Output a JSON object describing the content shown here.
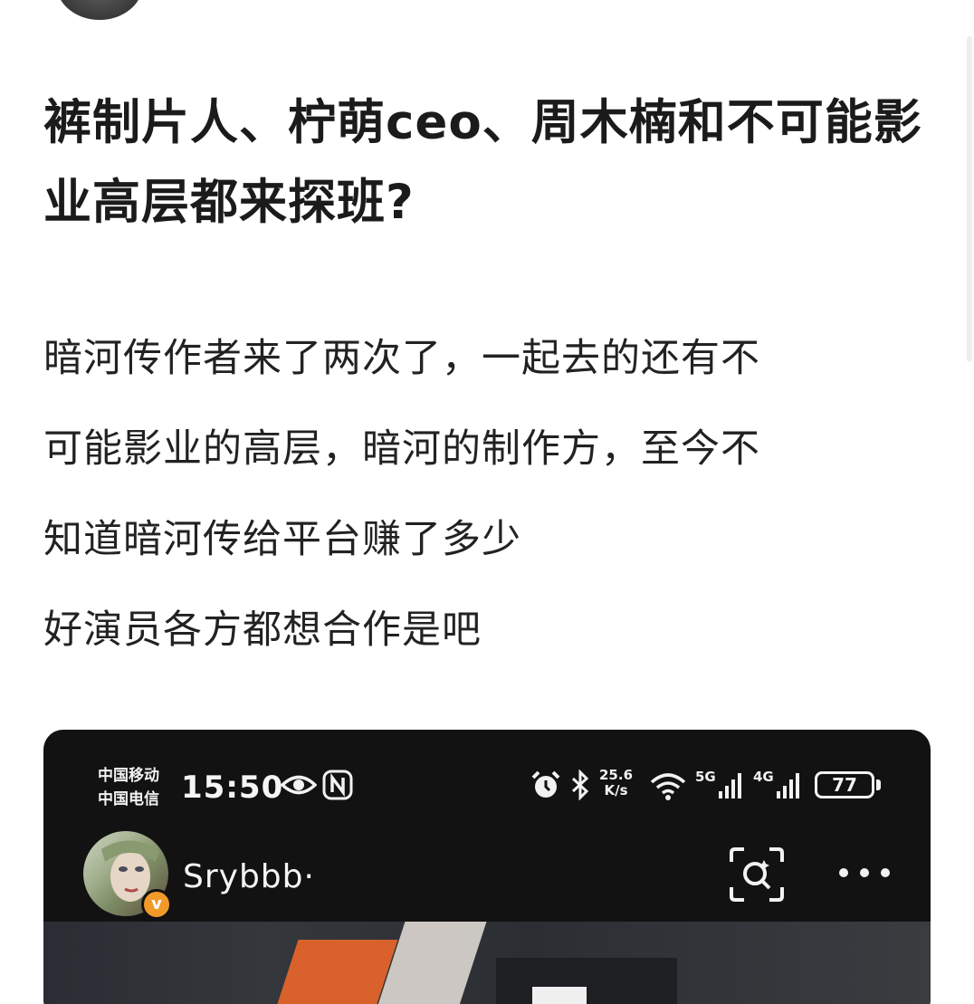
{
  "post": {
    "title": "裤制片人、柠萌ceo、周木楠和不可能影业高层都来探班?",
    "body_lines": [
      "暗河传作者来了两次了，一起去的还有不",
      "可能影业的高层，暗河的制作方，至今不",
      "知道暗河传给平台赚了多少",
      "好演员各方都想合作是吧"
    ]
  },
  "screenshot": {
    "status_bar": {
      "carrier_1": "中国移动",
      "carrier_2": "中国电信",
      "time": "15:50",
      "net_speed_value": "25.6",
      "net_speed_unit": "K/s",
      "signal_1_label": "5G",
      "signal_2_label": "4G",
      "battery": "77",
      "icons": [
        "eye-icon",
        "nfc-icon",
        "alarm-icon",
        "bluetooth-icon",
        "wifi-icon",
        "signal-icon"
      ]
    },
    "profile": {
      "name": "Srybbb·",
      "badge": "v",
      "icons": [
        "scan-icon",
        "more-icon"
      ]
    }
  }
}
